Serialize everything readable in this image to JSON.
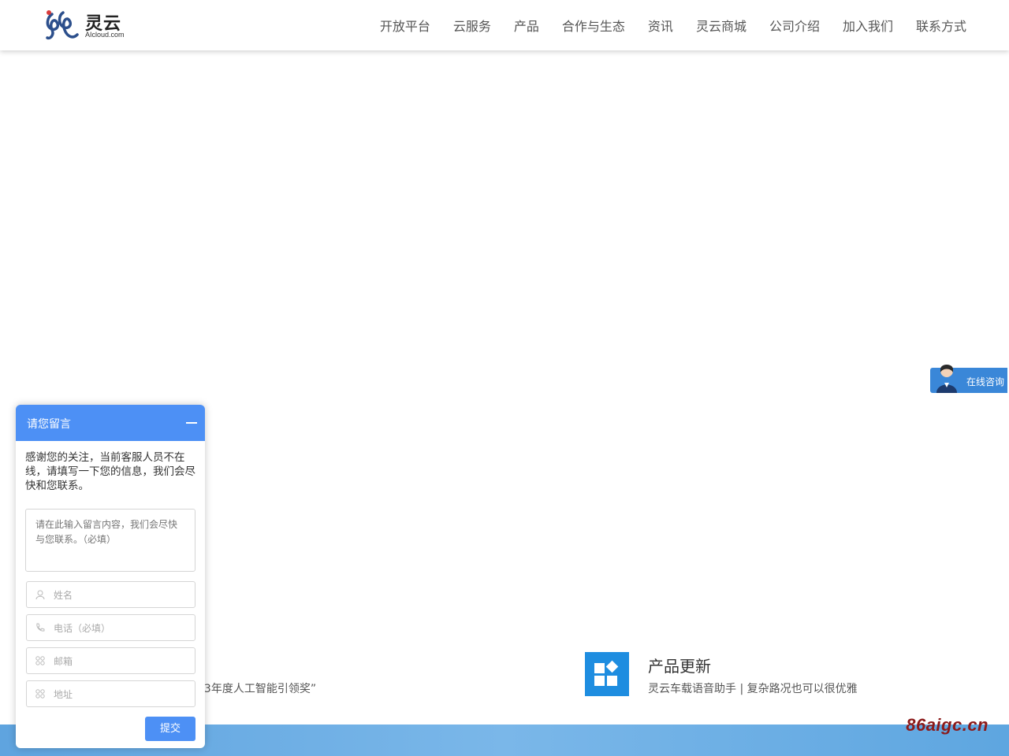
{
  "brand": {
    "name": "灵云",
    "domain": "AIcloud.com",
    "logo_icon": "aicloud-logo-icon"
  },
  "nav": {
    "items": [
      {
        "label": "开放平台"
      },
      {
        "label": "云服务"
      },
      {
        "label": "产品"
      },
      {
        "label": "合作与生态"
      },
      {
        "label": "资讯"
      },
      {
        "label": "灵云商城"
      },
      {
        "label": "公司介绍"
      },
      {
        "label": "加入我们"
      },
      {
        "label": "联系方式"
      }
    ]
  },
  "news": {
    "left_text": "23年度人工智能引领奖”",
    "product_update": {
      "title": "产品更新",
      "desc": "灵云车载语音助手 | 复杂路况也可以很优雅",
      "icon": "app-grid-icon"
    }
  },
  "consult": {
    "label": "在线咨询",
    "icon": "service-agent-avatar"
  },
  "chat": {
    "title": "请您留言",
    "intro": "感谢您的关注，当前客服人员不在线，请填写一下您的信息，我们会尽快和您联系。",
    "message_placeholder": "请在此输入留言内容，我们会尽快与您联系。（必填）",
    "fields": [
      {
        "placeholder": "姓名",
        "icon": "user-icon"
      },
      {
        "placeholder": "电话（必填）",
        "icon": "phone-icon"
      },
      {
        "placeholder": "邮箱",
        "icon": "email-icon"
      },
      {
        "placeholder": "地址",
        "icon": "address-icon"
      }
    ],
    "submit_label": "提交"
  },
  "watermark": "86aigc.cn",
  "colors": {
    "accent": "#4d90f5",
    "consult_tab": "#3a87d8",
    "footer_band": "#6aaee4",
    "watermark": "#8b1a1a"
  }
}
